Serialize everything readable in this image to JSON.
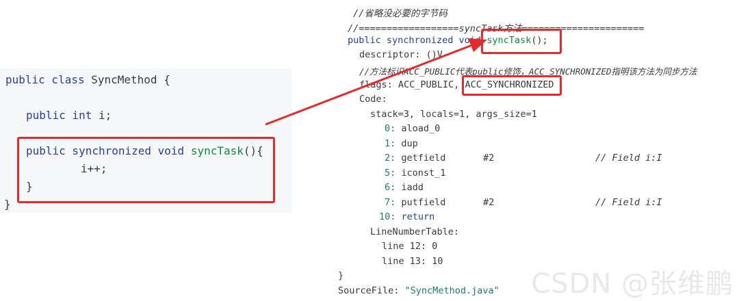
{
  "source": {
    "line1": {
      "kw": "public class",
      "name": "SyncMethod",
      "brace": "{"
    },
    "line2": {
      "kw": "public int",
      "name": "i;"
    },
    "line3": {
      "kw": "public synchronized void",
      "fn": "syncTask",
      "rest": "(){"
    },
    "line4": "i++;",
    "line5": "}",
    "line6": "}"
  },
  "bytecode": {
    "comment1": "//省略没必要的字节码",
    "comment2": "//==================syncTask方法======================",
    "signature_kw": "public synchronized void",
    "signature_fn": "syncTask",
    "signature_rest": "();",
    "descriptor": "descriptor: ()V",
    "comment3": "//方法标识ACC_PUBLIC代表public修饰，ACC_SYNCHRONIZED指明该方法为同步方法",
    "flags_label": "flags: ACC_PUBLIC,",
    "flags_sync": "ACC_SYNCHRONIZED",
    "code_label": "Code:",
    "stack_line": "stack=3, locals=1, args_size=1",
    "instructions": [
      {
        "idx": "0:",
        "op": "aload_0",
        "arg": "",
        "comment": ""
      },
      {
        "idx": "1:",
        "op": "dup",
        "arg": "",
        "comment": ""
      },
      {
        "idx": "2:",
        "op": "getfield",
        "arg": "#2",
        "comment": "// Field i:I"
      },
      {
        "idx": "5:",
        "op": "iconst_1",
        "arg": "",
        "comment": ""
      },
      {
        "idx": "6:",
        "op": "iadd",
        "arg": "",
        "comment": ""
      },
      {
        "idx": "7:",
        "op": "putfield",
        "arg": "#2",
        "comment": "// Field i:I"
      },
      {
        "idx": "10:",
        "op": "return",
        "arg": "",
        "comment": ""
      }
    ],
    "lnt_label": "LineNumberTable:",
    "lnt": [
      "line 12: 0",
      "line 13: 10"
    ],
    "close": "}",
    "sourcefile_label": "SourceFile:",
    "sourcefile_value": "\"SyncMethod.java\""
  },
  "watermark": "CSDN @张维鹏",
  "colors": {
    "highlight": "#e32b2b"
  }
}
